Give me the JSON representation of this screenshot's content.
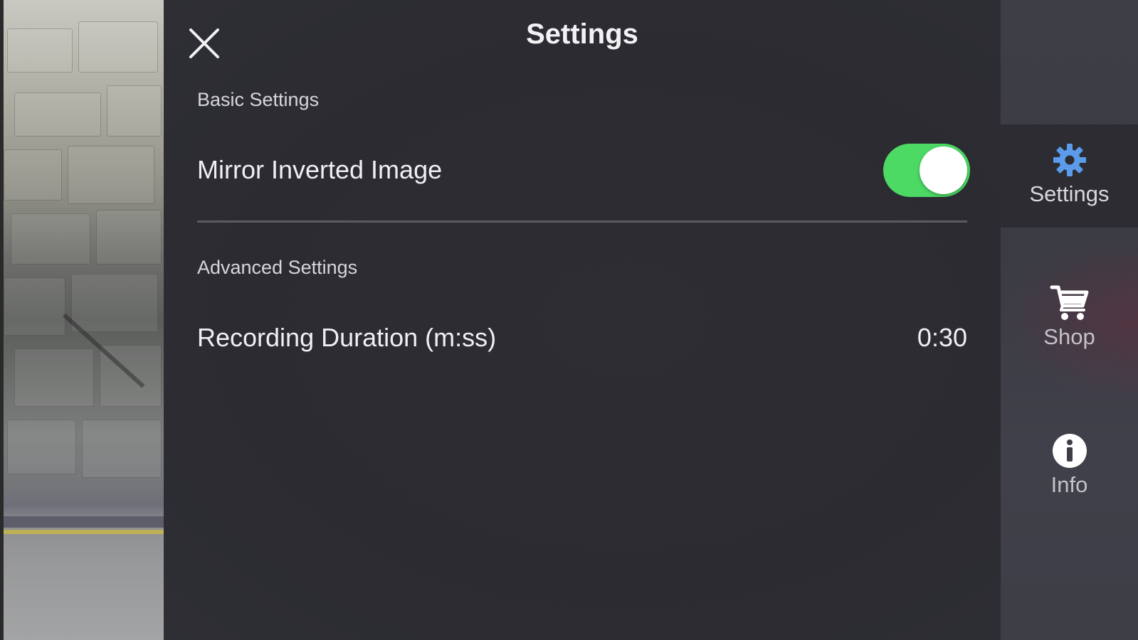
{
  "header": {
    "title": "Settings",
    "close_icon": "close-icon"
  },
  "sections": {
    "basic": {
      "header": "Basic Settings",
      "mirror_label": "Mirror Inverted Image",
      "mirror_enabled": true
    },
    "advanced": {
      "header": "Advanced Settings",
      "duration_label": "Recording Duration (m:ss)",
      "duration_value": "0:30"
    }
  },
  "side_nav": {
    "items": [
      {
        "label": "Settings",
        "icon": "gear-icon",
        "active": true
      },
      {
        "label": "Shop",
        "icon": "shopping-cart-icon",
        "active": false
      },
      {
        "label": "Info",
        "icon": "info-icon",
        "active": false
      }
    ]
  },
  "colors": {
    "toggle_on": "#4cd964",
    "active_nav": "#5b9bea",
    "panel_bg": "#2b2b31",
    "nav_bg": "#3e3f46"
  }
}
